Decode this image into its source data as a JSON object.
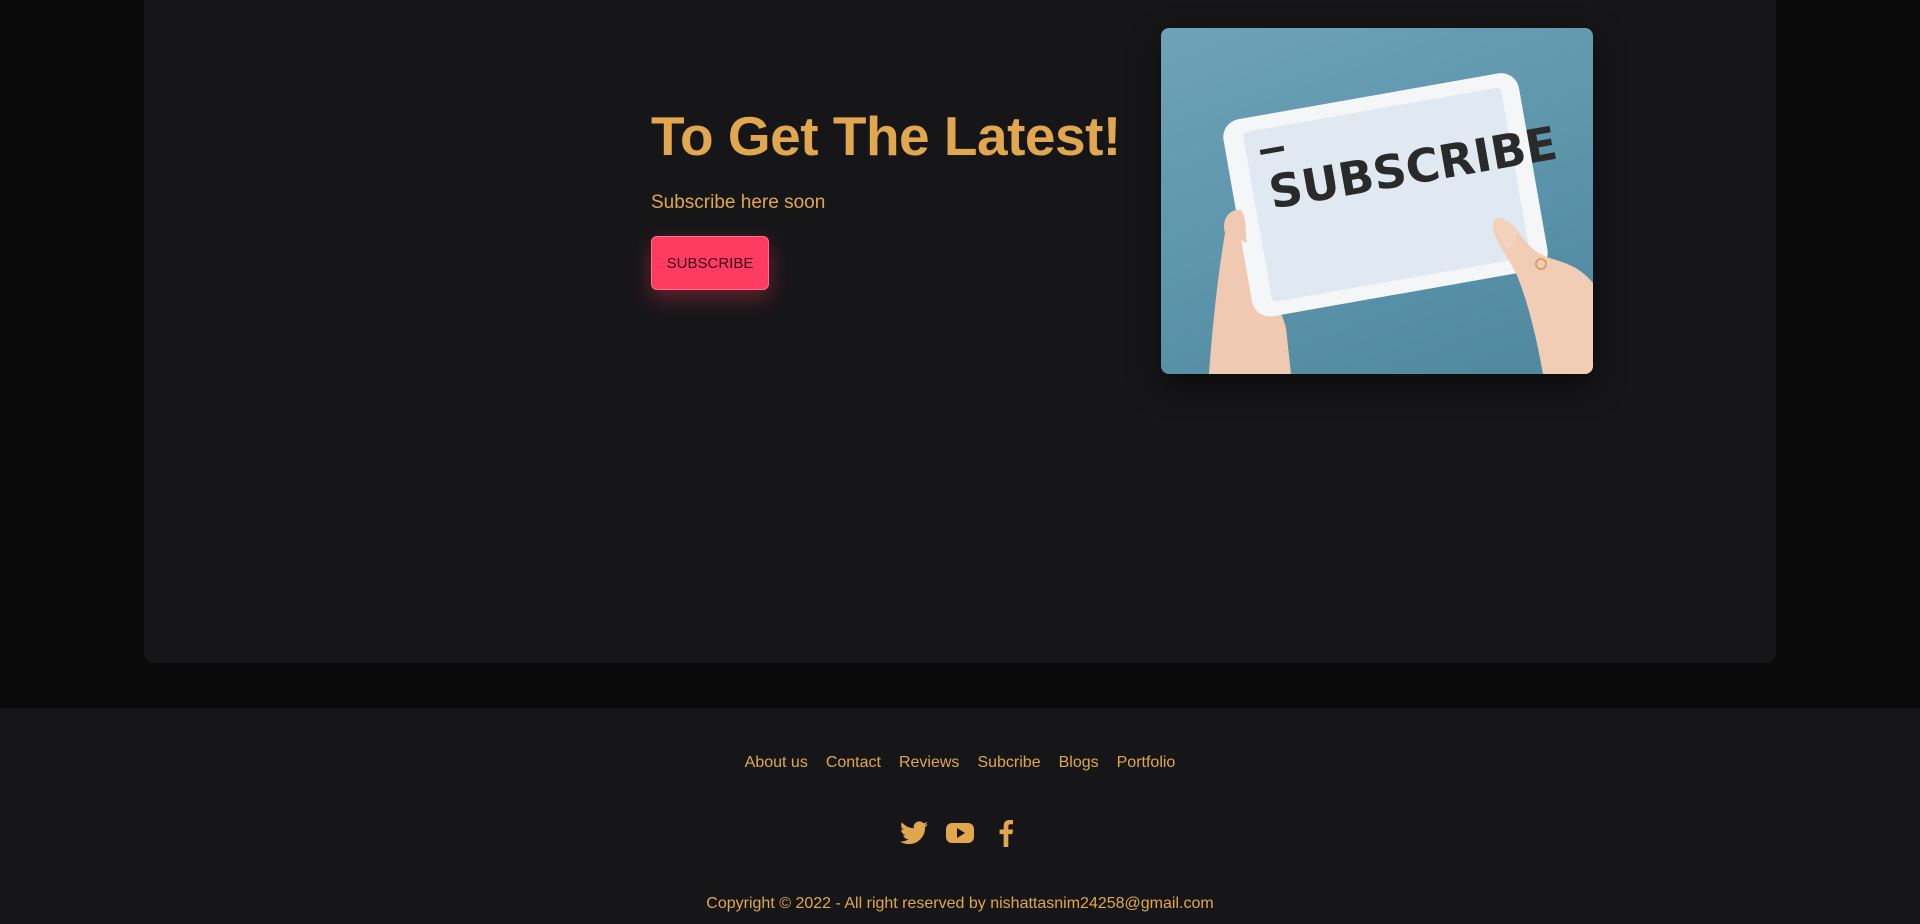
{
  "hero": {
    "title": "To Get The Latest!",
    "subtitle": "Subscribe here soon",
    "button_label": "SUBSCRIBE",
    "image_text": "SUBSCRIBE"
  },
  "footer": {
    "nav": [
      "About us",
      "Contact",
      "Reviews",
      "Subcribe",
      "Blogs",
      "Portfolio"
    ],
    "socials": [
      "twitter-icon",
      "youtube-icon",
      "facebook-icon"
    ],
    "copyright": "Copyright © 2022 - All right reserved by nishattasnim24258@gmail.com"
  },
  "colors": {
    "page_bg": "#0a0a0b",
    "card_bg": "#161618",
    "accent": "#e0a74e",
    "button": "#ff3b61"
  }
}
